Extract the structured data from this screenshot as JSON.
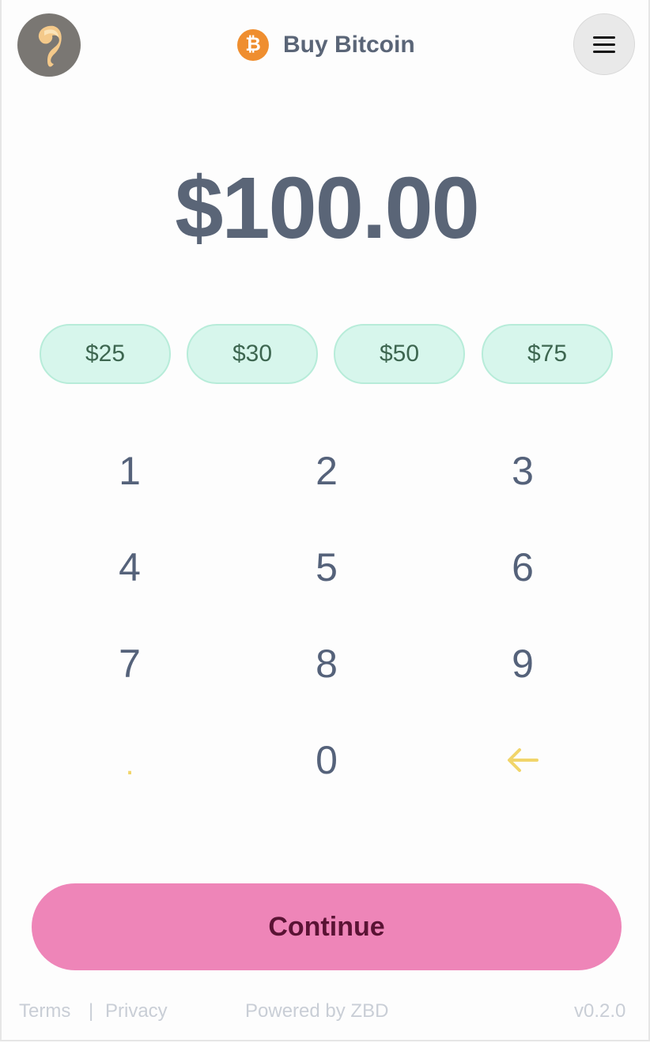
{
  "header": {
    "title": "Buy Bitcoin",
    "bitcoin_icon": "bitcoin-icon",
    "menu_icon": "hamburger-menu-icon",
    "logo_icon": "brand-logo"
  },
  "amount": {
    "display": "$100.00"
  },
  "quick_amounts": [
    "$25",
    "$30",
    "$50",
    "$75"
  ],
  "keypad": {
    "keys": [
      "1",
      "2",
      "3",
      "4",
      "5",
      "6",
      "7",
      "8",
      "9",
      ".",
      "0"
    ],
    "backspace_icon": "arrow-left-icon"
  },
  "continue_button": {
    "label": "Continue"
  },
  "footer": {
    "terms": "Terms",
    "separator": "|",
    "privacy": "Privacy",
    "powered_by": "Powered by ZBD",
    "version": "v0.2.0"
  },
  "colors": {
    "accent_pink": "#ee85b8",
    "quick_amount_bg": "#d7f6ec",
    "bitcoin_orange": "#ef8e2f",
    "text_slate": "#5a6577",
    "keypad_accent": "#f1d56a"
  }
}
